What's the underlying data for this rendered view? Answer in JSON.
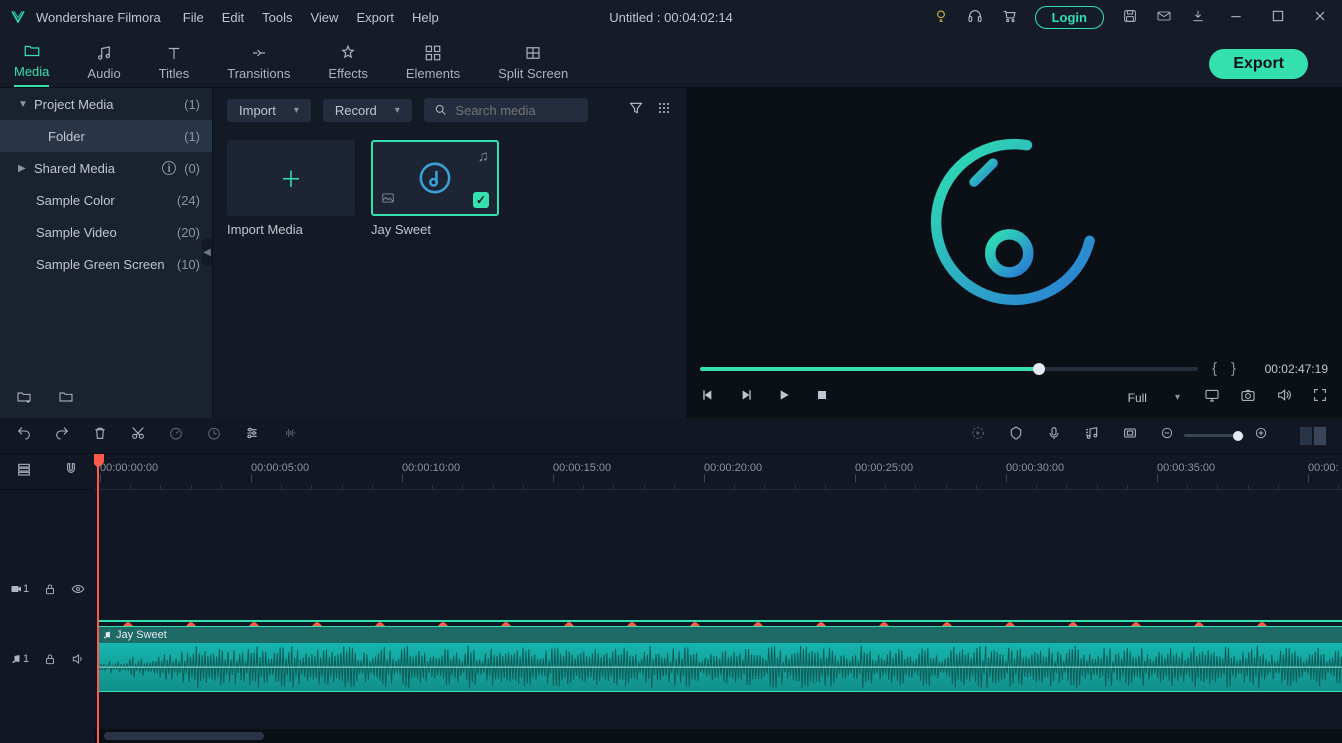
{
  "app": {
    "name": "Wondershare Filmora"
  },
  "menu": [
    "File",
    "Edit",
    "Tools",
    "View",
    "Export",
    "Help"
  ],
  "document_title": "Untitled : 00:04:02:14",
  "login_label": "Login",
  "tabs": [
    {
      "label": "Media"
    },
    {
      "label": "Audio"
    },
    {
      "label": "Titles"
    },
    {
      "label": "Transitions"
    },
    {
      "label": "Effects"
    },
    {
      "label": "Elements"
    },
    {
      "label": "Split Screen"
    }
  ],
  "export_label": "Export",
  "sidebar": {
    "items": [
      {
        "label": "Project Media",
        "count": "(1)"
      },
      {
        "label": "Folder",
        "count": "(1)"
      },
      {
        "label": "Shared Media",
        "count": "(0)"
      },
      {
        "label": "Sample Color",
        "count": "(24)"
      },
      {
        "label": "Sample Video",
        "count": "(20)"
      },
      {
        "label": "Sample Green Screen",
        "count": "(10)"
      }
    ]
  },
  "browser": {
    "import_label": "Import",
    "record_label": "Record",
    "search_placeholder": "Search media",
    "import_media_label": "Import Media",
    "clip1_name": "Jay Sweet"
  },
  "preview": {
    "time": "00:02:47:19",
    "quality": "Full"
  },
  "timeline": {
    "ticks": [
      "00:00:00:00",
      "00:00:05:00",
      "00:00:10:00",
      "00:00:15:00",
      "00:00:20:00",
      "00:00:25:00",
      "00:00:30:00",
      "00:00:35:00",
      "00:00:"
    ],
    "audio_clip_label": "Jay Sweet",
    "video_track_num": "1",
    "audio_track_num": "1"
  },
  "icons": {
    "bulb": "bulb-icon",
    "headphone": "headphone-icon",
    "cart": "cart-icon",
    "save": "save-icon",
    "mail": "mail-icon",
    "download": "download-icon",
    "minimize": "minimize-icon",
    "maximize": "maximize-icon",
    "close": "close-icon"
  }
}
